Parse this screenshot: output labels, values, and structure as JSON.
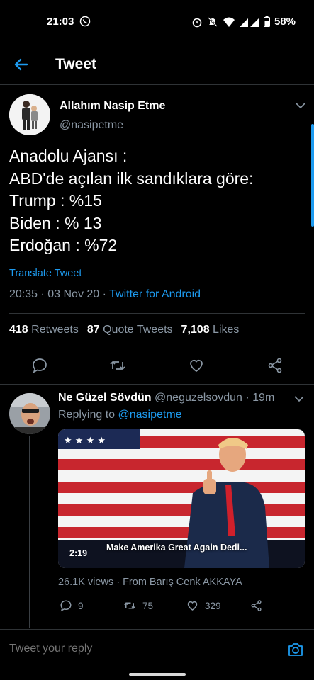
{
  "status_bar": {
    "time": "21:03",
    "battery": "58%"
  },
  "header": {
    "title": "Tweet"
  },
  "tweet": {
    "author_name": "Allahım Nasip Etme",
    "author_handle": "@nasipetme",
    "lines": [
      "Anadolu Ajansı :",
      "ABD'de açılan ilk sandıklara göre:",
      "Trump : %15",
      "Biden : % 13",
      "Erdoğan : %72"
    ],
    "translate_label": "Translate Tweet",
    "timestamp": "20:35 · 03 Nov 20 · ",
    "source": "Twitter for Android",
    "stats": {
      "retweets_count": "418",
      "retweets_label": "Retweets",
      "quotes_count": "87",
      "quotes_label": "Quote Tweets",
      "likes_count": "7,108",
      "likes_label": "Likes"
    }
  },
  "reply": {
    "author_name": "Ne Güzel Sövdün",
    "author_handle": "@neguzelsovdun",
    "time": " · 19m",
    "replying_prefix": "Replying to ",
    "replying_to": "@nasipetme",
    "video_duration": "2:19",
    "video_caption": "Make Amerika Great Again Dedi...",
    "views_text": "26.1K views · From Barış Cenk AKKAYA",
    "reply_count": "9",
    "retweet_count": "75",
    "like_count": "329"
  },
  "composer": {
    "placeholder": "Tweet your reply"
  },
  "colors": {
    "accent": "#1d9bf0",
    "background": "#000000",
    "secondary_text": "#8b98a5"
  }
}
